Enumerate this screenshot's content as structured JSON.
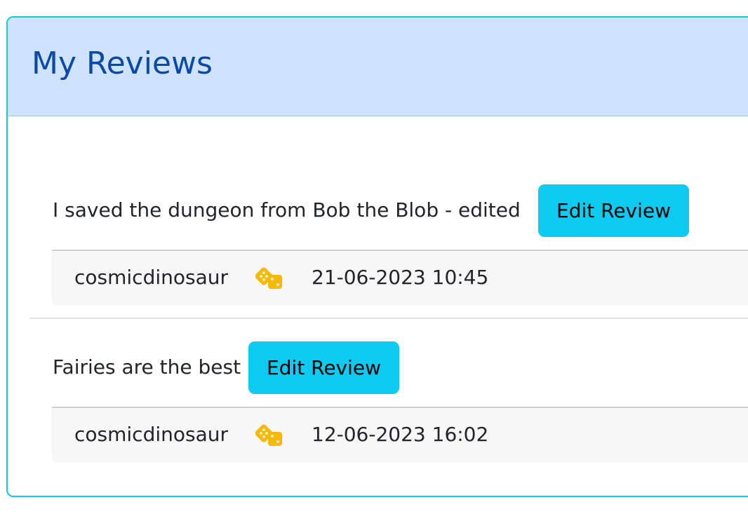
{
  "card": {
    "title": "My Reviews"
  },
  "reviews": [
    {
      "text": "I saved the dungeon from Bob the Blob - edited",
      "edit_label": "Edit Review",
      "username": "cosmicdinosaur",
      "icon": "dice-icon",
      "timestamp": "21-06-2023 10:45"
    },
    {
      "text": "Fairies are the best",
      "edit_label": "Edit Review",
      "username": "cosmicdinosaur",
      "icon": "dice-icon",
      "timestamp": "12-06-2023 16:02"
    }
  ],
  "colors": {
    "header_bg": "#cfe2ff",
    "title_color": "#0a4aa6",
    "button_bg": "#0dcaf0",
    "card_border": "#0dcaf0",
    "icon_color": "#f5b90a"
  }
}
